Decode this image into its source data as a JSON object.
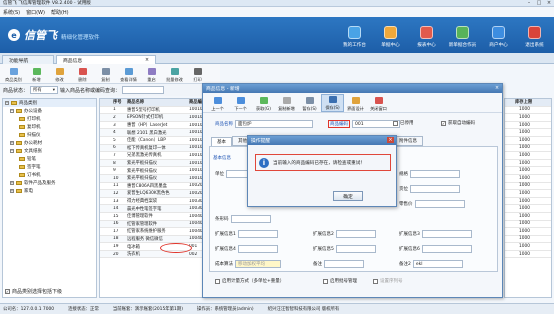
{
  "window": {
    "title": "信管飞 飞信库管理软件 V8.2.400 - 试用版"
  },
  "menu": [
    "系统(S)",
    "窗口(W)",
    "帮助(H)"
  ],
  "header": {
    "logo": "信管飞",
    "slogan": "精细化管理软件",
    "buttons": [
      "我的工作台",
      "单据中心",
      "报表中心",
      "新单据合作员",
      "商户中心",
      "退出系统"
    ]
  },
  "tabs": [
    "功能导航",
    "商品信息"
  ],
  "toolbar": [
    "商品类别",
    "新增",
    "修改",
    "删除",
    "复制",
    "查看详情",
    "重启",
    "批量修改",
    "打印",
    "导出",
    "导入"
  ],
  "filter": {
    "status_label": "商品状态：",
    "status_value": "所有",
    "search_label": "输入商品名称或编码查询：",
    "search_value": ""
  },
  "tree": {
    "root": "商品类别",
    "items": [
      {
        "label": "办公设备",
        "level": 1,
        "expanded": true
      },
      {
        "label": "打印机",
        "level": 2
      },
      {
        "label": "复印机",
        "level": 2
      },
      {
        "label": "扫描仪",
        "level": 2
      },
      {
        "label": "办公耗材",
        "level": 1
      },
      {
        "label": "文具纸张",
        "level": 1,
        "expanded": true
      },
      {
        "label": "铅笔",
        "level": 2
      },
      {
        "label": "签字笔",
        "level": 2
      },
      {
        "label": "订书机",
        "level": 2
      },
      {
        "label": "软件产品及服务",
        "level": 1
      },
      {
        "label": "家电",
        "level": 1
      }
    ],
    "checkbox_label": "商品类别选择包括下级"
  },
  "grid": {
    "headers": [
      "",
      "序号",
      "商品名称",
      "商品编码"
    ],
    "rows": [
      [
        "",
        "1",
        "惠普5型号打印机",
        "1001001"
      ],
      [
        "",
        "2",
        "EPSON针式打印机",
        "1001002"
      ],
      [
        "",
        "3",
        "惠普（HP）LaserJet",
        "1001003"
      ],
      [
        "",
        "4",
        "联想 2101 黑白激光",
        "1001004"
      ],
      [
        "",
        "5",
        "佳能（Canon）LBP",
        "1001005"
      ],
      [
        "",
        "6",
        "松下传真机复印一体",
        "1001006"
      ],
      [
        "",
        "7",
        "兄弟黑激光传真机",
        "1001007"
      ],
      [
        "",
        "8",
        "紫光平板扫描仪",
        "1001008"
      ],
      [
        "",
        "9",
        "紫光平板扫描仪",
        "1001009"
      ],
      [
        "",
        "10",
        "紫光平板扫描仪",
        "1001010"
      ],
      [
        "",
        "11",
        "惠普C806A四黑墨盒",
        "1002001"
      ],
      [
        "",
        "12",
        "爱普生LQ630K黑色色",
        "1002002"
      ],
      [
        "",
        "13",
        "得力经典档案袋",
        "1003001"
      ],
      [
        "",
        "14",
        "晨光中性笔签字笔",
        "1003002"
      ],
      [
        "",
        "15",
        "佳博管理软件",
        "1004001"
      ],
      [
        "",
        "16",
        "红管家管理软件",
        "1004002"
      ],
      [
        "",
        "17",
        "红管家系统维护服务",
        "1004003"
      ],
      [
        "",
        "18",
        "远程服务 微信微信",
        "1004004"
      ],
      [
        "",
        "19",
        "电冰箱",
        "001"
      ],
      [
        "",
        "20",
        "洗衣机",
        "002"
      ]
    ]
  },
  "rightcol": {
    "header": "库存上限",
    "values": [
      "1000",
      "1000",
      "1000",
      "1000",
      "1000",
      "1000",
      "1000",
      "1000",
      "1000",
      "1000",
      "1000",
      "1000",
      "1000",
      "1000",
      "1000",
      "1000",
      "1000",
      "1000",
      "1000",
      "1000"
    ]
  },
  "dialog": {
    "title": "商品信息 - 新增",
    "tools": [
      "上一个",
      "下一个",
      "获取(G)",
      "复制新增",
      "暂存(S)",
      "保存(S)",
      "界面设计",
      "关闭窗口"
    ],
    "name_label": "商品名称",
    "name_value": "面包炉",
    "code_label": "商品编码",
    "code_value": "001",
    "disabled_label": "已停用",
    "autocode_label": "获取自动编码",
    "tabs": [
      "基本",
      "其他",
      "附件信息"
    ],
    "section": "基本信息",
    "fields": {
      "unit": "单位",
      "spec": "规格",
      "brand": "品牌",
      "loc": "货位",
      "barcode": "条形码",
      "price": "零售价",
      "e1": "扩展信息1",
      "e2": "扩展信息2",
      "e3": "扩展信息3",
      "e4": "扩展信息4",
      "e5": "扩展信息5",
      "e6": "扩展信息6",
      "cost_label": "成本算法",
      "cost_value": "移动加权平均",
      "remark": "备注",
      "remark_value": "",
      "weight": "备注2",
      "weight_value": "ekl"
    },
    "bottom": [
      "启用计量方式（多单位+重量）",
      "启用批号管理",
      "设置序列号"
    ]
  },
  "alert": {
    "title": "操作提醒",
    "message": "当前输入的商品编码已存在，请检查或重试！",
    "ok": "确定"
  },
  "status": [
    "公司名：127.0.0.1 7000",
    "连接状态：正常",
    "当前账套：演示账套(2015年第1期)",
    "操作员：系统管理员(admin)",
    "绍兴汪汪智智科技有限公司 版权所有"
  ]
}
